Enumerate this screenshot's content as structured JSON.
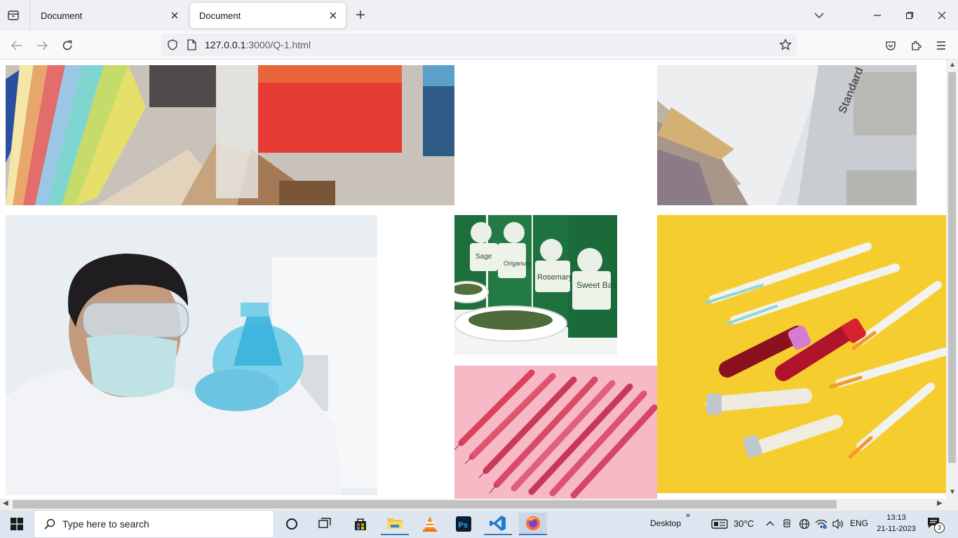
{
  "browser": {
    "tabs": [
      {
        "title": "Document",
        "active": false
      },
      {
        "title": "Document",
        "active": true
      }
    ],
    "url_host": "127.0.0.1",
    "url_rest": ":3000/Q-1.html"
  },
  "page": {
    "images": [
      {
        "name": "color-swatches-fabric-samples",
        "description": "color swatches with fabric samples"
      },
      {
        "name": "paint-samples-standard",
        "description": "paint and material samples"
      },
      {
        "name": "scientist-with-flask",
        "description": "scientist in mask holding blue flask"
      },
      {
        "name": "spice-jars-herbs",
        "description": "Robertsons herb jars"
      },
      {
        "name": "syringes-on-yellow",
        "description": "syringes and blood tubes on yellow"
      },
      {
        "name": "syringes-on-pink",
        "description": "red syringes on pink"
      }
    ],
    "jar_labels": [
      "Sage",
      "Origanum",
      "Rosemary",
      "Sweet Basil"
    ],
    "swatch_label": "Standard"
  },
  "taskbar": {
    "search_placeholder": "Type here to search",
    "desktop_label": "Desktop",
    "weather": "30°C",
    "language": "ENG",
    "time": "13:13",
    "date": "21-11-2023",
    "notification_count": "3"
  },
  "colors": {
    "accent": "#3b78c4",
    "chrome_bg": "#f0f0f4",
    "taskbar_bg": "#dde6f0"
  }
}
